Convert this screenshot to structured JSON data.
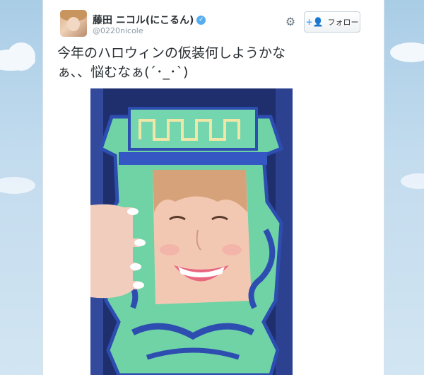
{
  "tweet": {
    "author_name": "藤田 ニコル(にこるん)",
    "handle": "@0220nicole",
    "text_line1": "今年のハロウィンの仮装何しようかな",
    "text_line2": "ぁ、、悩むなぁ(´･_･`)",
    "verified_glyph": "✓"
  },
  "actions": {
    "follow_label": "フォロー",
    "follow_icon": "add-user-icon",
    "settings_icon": "gear-icon"
  },
  "colors": {
    "verified": "#55acee",
    "text": "#292f33",
    "handle": "#8899a6",
    "page_background": "#c7dff0"
  }
}
